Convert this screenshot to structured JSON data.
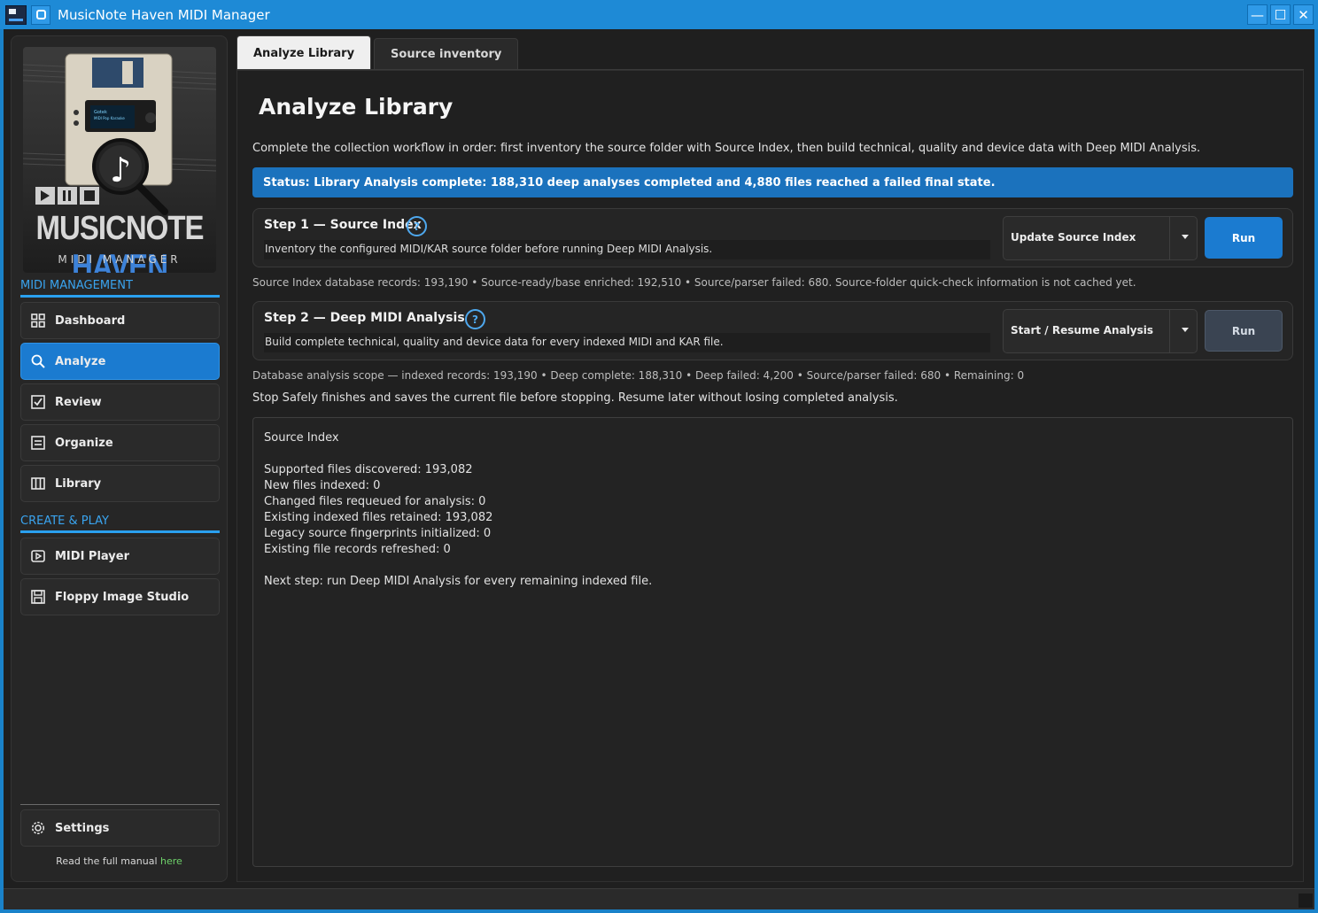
{
  "window": {
    "title": "MusicNote Haven MIDI Manager",
    "minimize": "—",
    "maximize": "☐",
    "close": "✕"
  },
  "logo": {
    "brand_main": "MUSICNOTE ",
    "brand_accent": "HAVEN",
    "subtitle": "MIDI MANAGER",
    "screen_line1": "Gotek",
    "screen_line2": "MIDI Pop Karaoke"
  },
  "sidebar": {
    "section_management": "MIDI MANAGEMENT",
    "section_create": "CREATE & PLAY",
    "items": [
      {
        "label": "Dashboard",
        "icon": "grid-icon"
      },
      {
        "label": "Analyze",
        "icon": "magnifier-icon"
      },
      {
        "label": "Review",
        "icon": "checkbox-icon"
      },
      {
        "label": "Organize",
        "icon": "list-icon"
      },
      {
        "label": "Library",
        "icon": "columns-icon"
      },
      {
        "label": "MIDI Player",
        "icon": "player-icon"
      },
      {
        "label": "Floppy Image Studio",
        "icon": "floppy-icon"
      }
    ],
    "settings_label": "Settings",
    "manual_text": "Read the full manual ",
    "manual_link": "here"
  },
  "tabs": [
    {
      "label": "Analyze Library",
      "active": true
    },
    {
      "label": "Source inventory",
      "active": false
    }
  ],
  "main": {
    "title": "Analyze Library",
    "intro": "Complete the collection workflow in order: first inventory the source folder with Source Index, then build technical, quality and device data with Deep MIDI Analysis.",
    "status": "Status: Library Analysis complete: 188,310 deep analyses completed and 4,880 files reached a failed final state.",
    "step1": {
      "title": "Step 1 — Source Index",
      "help": "?",
      "description": "Inventory the configured MIDI/KAR source folder before running Deep MIDI Analysis.",
      "dropdown_value": "Update Source Index",
      "run_label": "Run",
      "info": "Source Index database records: 193,190 • Source-ready/base enriched: 192,510 • Source/parser failed: 680. Source-folder quick-check information is not cached yet."
    },
    "step2": {
      "title": "Step 2 — Deep MIDI Analysis",
      "help": "?",
      "description": "Build complete technical, quality and device data for every indexed MIDI and KAR file.",
      "dropdown_value": "Start / Resume Analysis",
      "run_label": "Run",
      "info": "Database analysis scope — indexed records: 193,190 • Deep complete: 188,310 • Deep failed: 4,200 • Source/parser failed: 680 • Remaining: 0"
    },
    "stop_note": "Stop Safely finishes and saves the current file before stopping. Resume later without losing completed analysis.",
    "log": [
      "Source Index",
      "",
      "Supported files discovered: 193,082",
      "New files indexed: 0",
      "Changed files requeued for analysis: 0",
      "Existing indexed files retained: 193,082",
      "Legacy source fingerprints initialized: 0",
      "Existing file records refreshed: 0",
      "",
      "Next step: run Deep MIDI Analysis for every remaining indexed file."
    ]
  },
  "colors": {
    "accent": "#1b7bd0",
    "titlebar": "#1e8ad6",
    "section_heading": "#3aa4ef",
    "link": "#6ed16a"
  }
}
